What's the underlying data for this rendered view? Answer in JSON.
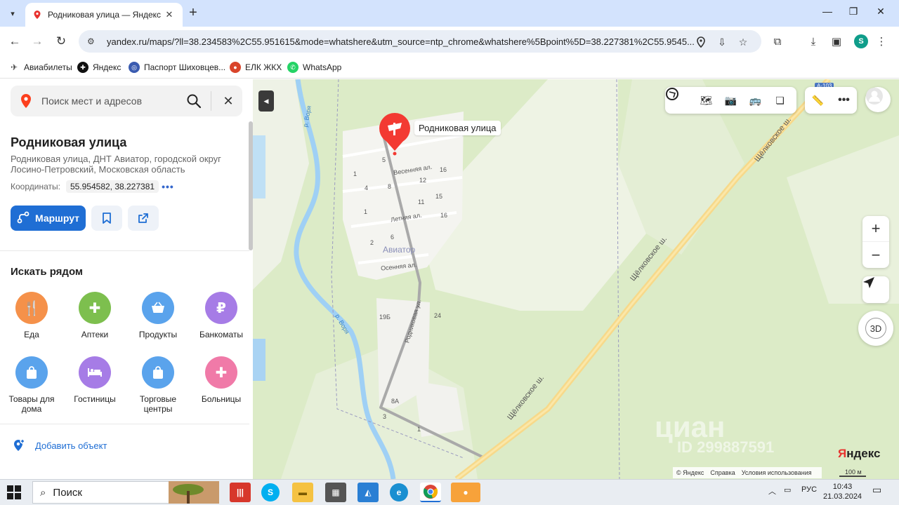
{
  "browser": {
    "tab_title": "Родниковая улица — Яндекс Карты",
    "new_tab": "+",
    "url": "yandex.ru/maps/?ll=38.234583%2C55.951615&mode=whatshere&utm_source=ntp_chrome&whatshere%5Bpoint%5D=38.227381%2C55.9545...",
    "profile_initial": "S",
    "bookmarks": [
      "Авиабилеты",
      "Яндекс",
      "Паспорт Шиховцев...",
      "ЕЛК ЖКХ",
      "WhatsApp"
    ]
  },
  "panel": {
    "search_placeholder": "Поиск мест и адресов",
    "place_title": "Родниковая улица",
    "place_subtitle": "Родниковая улица, ДНТ Авиатор, городской округ Лосино-Петровский, Московская область",
    "coords_label": "Координаты:",
    "coords_value": "55.954582, 38.227381",
    "coords_more": "•••",
    "route_label": "Маршрут",
    "nearby_title": "Искать рядом",
    "categories": [
      {
        "label": "Еда",
        "icon": "fork-knife-icon",
        "color": "#f5914a"
      },
      {
        "label": "Аптеки",
        "icon": "cross-icon",
        "color": "#7dbf4e"
      },
      {
        "label": "Продукты",
        "icon": "basket-icon",
        "color": "#5aa3ec"
      },
      {
        "label": "Банкоматы",
        "icon": "ruble-icon",
        "color": "#a67ce6"
      },
      {
        "label": "Товары для дома",
        "icon": "bag-icon",
        "color": "#5aa3ec"
      },
      {
        "label": "Гостиницы",
        "icon": "bed-icon",
        "color": "#a67ce6"
      },
      {
        "label": "Торговые центры",
        "icon": "bag-icon",
        "color": "#5aa3ec"
      },
      {
        "label": "Больницы",
        "icon": "cross-icon",
        "color": "#f07aa8"
      }
    ],
    "add_object": "Добавить объект"
  },
  "map": {
    "pin_label": "Родниковая улица",
    "labels": {
      "river_1": "р. Воря",
      "river_2": "р. Воря",
      "street_vesennyaya": "Весенняя ал.",
      "street_letnyaya": "Летняя ал.",
      "street_osennyaya": "Осенняя ал.",
      "street_rodnikovaya": "Родниковая ул.",
      "settlement": "Авиатор",
      "highway_1": "Щёлковское ш.",
      "highway_2": "Щёлковское ш.",
      "highway_3": "Щёлковское ш.",
      "road_badge": "А-103",
      "house_1": "1",
      "house_5": "5",
      "house_16a": "16",
      "house_4": "4",
      "house_8": "8",
      "house_12": "12",
      "house_11": "11",
      "house_15": "15",
      "house_16b": "16",
      "house_1b": "1",
      "house_6": "6",
      "house_2": "2",
      "house_19b": "19Б",
      "house_24": "24",
      "house_8a": "8А",
      "house_3": "3",
      "house_1c": "1"
    },
    "zoom_in": "+",
    "zoom_out": "−",
    "btn_3d": "3D",
    "footer": [
      "© Яндекс",
      "Справка",
      "Условия использования"
    ],
    "scale": "100 м",
    "brand_first": "Я",
    "brand_rest": "ндекс",
    "watermark": "циан",
    "watermark_id": "ID 299887591"
  },
  "taskbar": {
    "search_label": "Поиск",
    "lang": "РУС",
    "time": "10:43",
    "date": "21.03.2024"
  }
}
